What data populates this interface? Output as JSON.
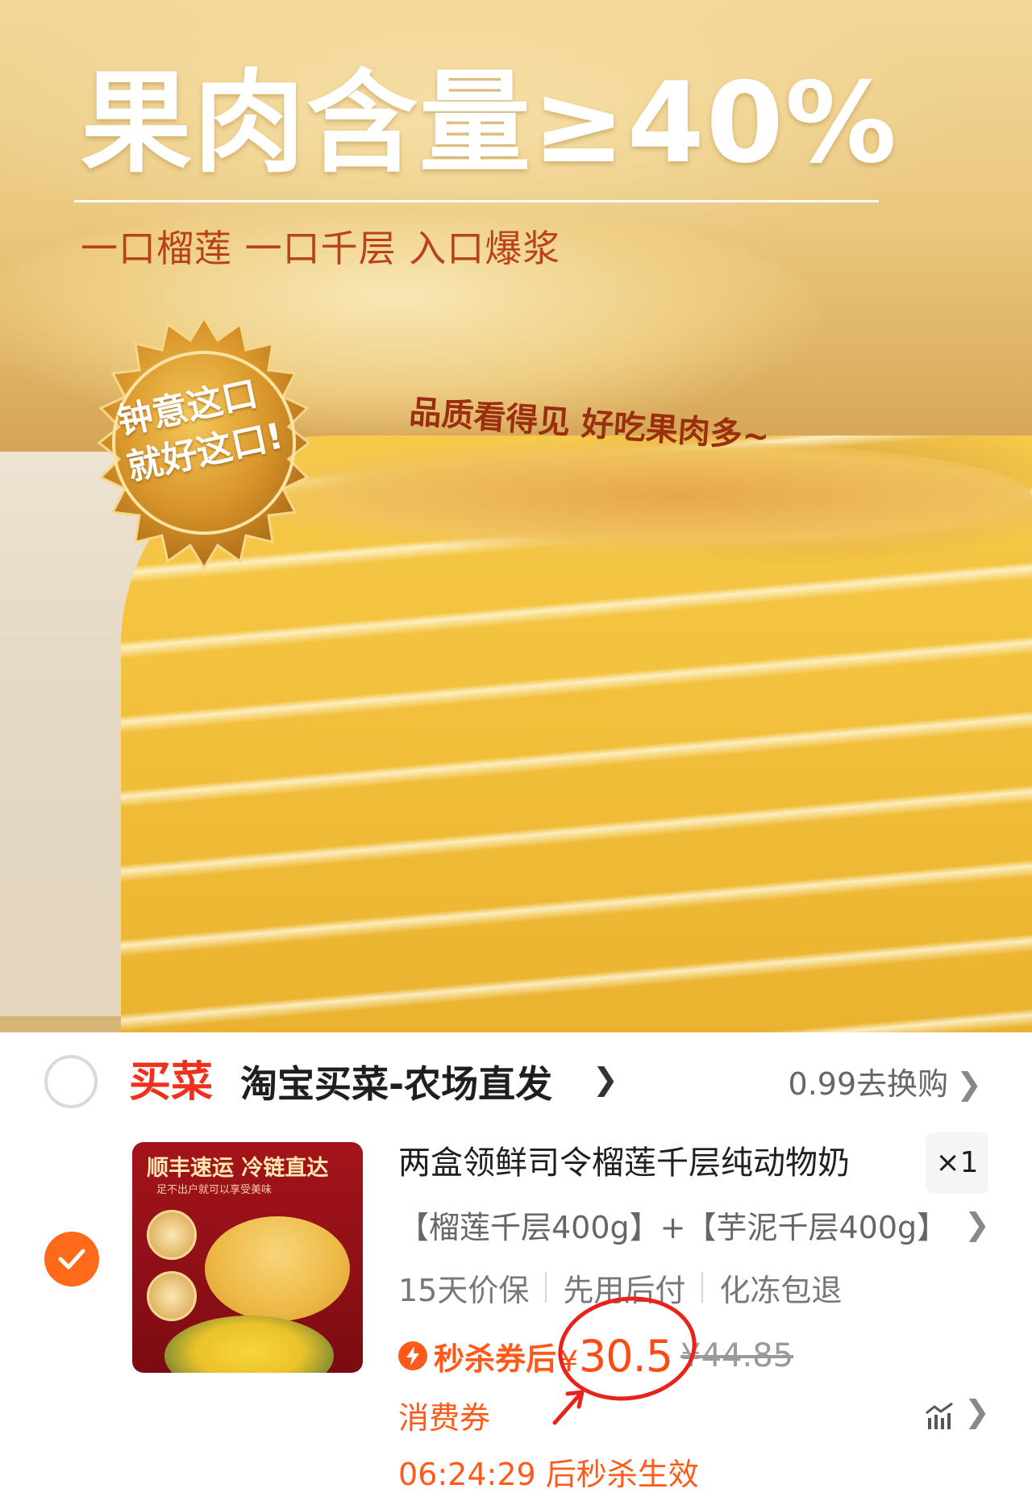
{
  "hero": {
    "headline": "果肉含量≥40%",
    "subline": "一口榴莲 一口千层 入口爆浆",
    "tagline": "品质看得见 好吃果肉多~",
    "seal_line1": "钟意这口",
    "seal_line2": "就好这口!"
  },
  "store": {
    "logo": "买菜",
    "name": "淘宝买菜-农场直发",
    "promo": "0.99去换购"
  },
  "product": {
    "thumb_title": "顺丰速运 冷链直达",
    "thumb_subtitle": "足不出户就可以享受美味",
    "title": "两盒领鲜司令榴莲千层纯动物奶",
    "quantity": "×1",
    "sku": "【榴莲千层400g】+【芋泥千层400g】",
    "services": [
      "15天价保",
      "先用后付",
      "化冻包退"
    ],
    "flash_label": "秒杀券后",
    "currency": "¥",
    "price": "30.5",
    "original_price": "¥44.85",
    "coupon": "消费券",
    "countdown": "06:24:29 后秒杀生效",
    "selected": true
  },
  "colors": {
    "accent": "#ff5a1a",
    "logo_red": "#f0301c",
    "annotation_red": "#e8231b"
  }
}
